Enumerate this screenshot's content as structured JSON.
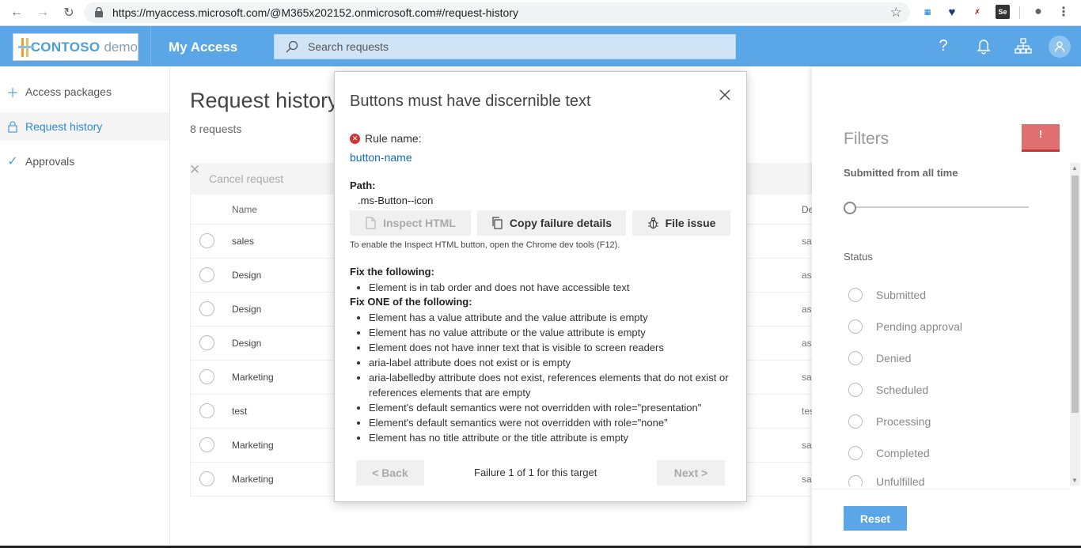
{
  "browser": {
    "url": "https://myaccess.microsoft.com/@M365x202152.onmicrosoft.com#/request-history"
  },
  "header": {
    "logo_brand": "CONTOSO",
    "logo_suffix": "demo",
    "app_title": "My Access",
    "search_placeholder": "Search requests"
  },
  "sidebar": {
    "items": [
      {
        "label": "Access packages",
        "icon": "plus-icon"
      },
      {
        "label": "Request history",
        "icon": "lock-icon",
        "active": true
      },
      {
        "label": "Approvals",
        "icon": "check-icon"
      }
    ]
  },
  "main": {
    "title": "Request history",
    "count": "8 requests",
    "cancel_label": "Cancel request",
    "columns": {
      "name": "Name",
      "description": "De"
    },
    "rows": [
      {
        "name": "sales",
        "desc": "sal"
      },
      {
        "name": "Design",
        "desc": "asc"
      },
      {
        "name": "Design",
        "desc": "asc"
      },
      {
        "name": "Design",
        "desc": "asc"
      },
      {
        "name": "Marketing",
        "desc": "sac"
      },
      {
        "name": "test",
        "desc": "tes"
      },
      {
        "name": "Marketing",
        "desc": "sac"
      },
      {
        "name": "Marketing",
        "desc": "sac"
      }
    ]
  },
  "filters": {
    "title": "Filters",
    "alert_badge": "!",
    "submitted_label": "Submitted from all time",
    "status_label": "Status",
    "options": [
      "Submitted",
      "Pending approval",
      "Denied",
      "Scheduled",
      "Processing",
      "Completed",
      "Unfulfilled"
    ],
    "reset_label": "Reset"
  },
  "dialog": {
    "title": "Buttons must have discernible text",
    "rule_label": "Rule name:",
    "rule_name": "button-name",
    "path_label": "Path:",
    "path_value": ".ms-Button--icon",
    "inspect_label": "Inspect HTML",
    "copy_label": "Copy failure details",
    "file_label": "File issue",
    "note": "To enable the Inspect HTML button, open the Chrome dev tools (F12).",
    "fix_all_heading": "Fix the following:",
    "fix_all": [
      "Element is in tab order and does not have accessible text"
    ],
    "fix_one_heading": "Fix ONE of the following:",
    "fix_one": [
      "Element has a value attribute and the value attribute is empty",
      "Element has no value attribute or the value attribute is empty",
      "Element does not have inner text that is visible to screen readers",
      "aria-label attribute does not exist or is empty",
      "aria-labelledby attribute does not exist, references elements that do not exist or references elements that are empty",
      "Element's default semantics were not overridden with role=\"presentation\"",
      "Element's default semantics were not overridden with role=\"none\"",
      "Element has no title attribute or the title attribute is empty"
    ],
    "back_label": "< Back",
    "next_label": "Next >",
    "failure_count": "Failure 1 of 1 for this target"
  }
}
